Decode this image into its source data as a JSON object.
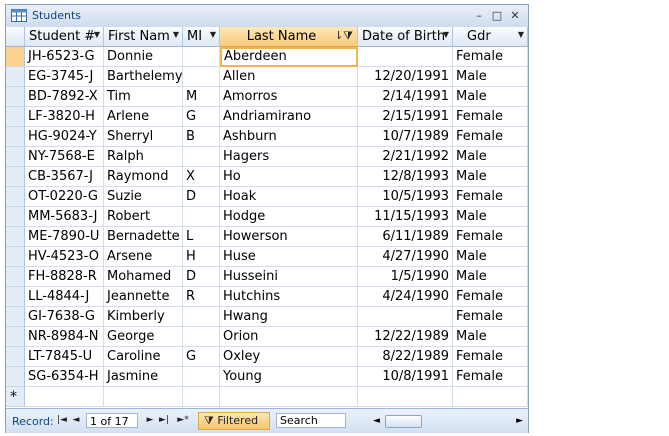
{
  "window": {
    "title": "Students",
    "minimize": "–",
    "maximize": "□",
    "close": "✕"
  },
  "columns": [
    {
      "label": "Student #",
      "has_dropdown": true
    },
    {
      "label": "First Nam",
      "has_dropdown": true
    },
    {
      "label": "MI",
      "has_dropdown": true
    },
    {
      "label": "Last Name",
      "sorted": true,
      "filtered": true
    },
    {
      "label": "Date of Birth",
      "has_dropdown": true
    },
    {
      "label": "Gdr",
      "has_dropdown": true
    }
  ],
  "rows": [
    [
      "JH-6523-G",
      "Donnie",
      "",
      "Aberdeen",
      "",
      ""
    ],
    [
      "EG-3745-J",
      "Barthelemy",
      "",
      "Allen",
      "12/20/1991",
      "Male"
    ],
    [
      "BD-7892-X",
      "Tim",
      "M",
      "Amorros",
      "2/14/1991",
      "Male"
    ],
    [
      "LF-3820-H",
      "Arlene",
      "G",
      "Andriamirano",
      "2/15/1991",
      "Female"
    ],
    [
      "HG-9024-Y",
      "Sherryl",
      "B",
      "Ashburn",
      "10/7/1989",
      "Female"
    ],
    [
      "NY-7568-E",
      "Ralph",
      "",
      "Hagers",
      "2/21/1992",
      "Male"
    ],
    [
      "CB-3567-J",
      "Raymond",
      "X",
      "Ho",
      "12/8/1993",
      "Male"
    ],
    [
      "OT-0220-G",
      "Suzie",
      "D",
      "Hoak",
      "10/5/1993",
      "Female"
    ],
    [
      "MM-5683-J",
      "Robert",
      "",
      "Hodge",
      "11/15/1993",
      "Male"
    ],
    [
      "ME-7890-U",
      "Bernadette",
      "L",
      "Howerson",
      "6/11/1989",
      "Female"
    ],
    [
      "HV-4523-O",
      "Arsene",
      "H",
      "Huse",
      "4/27/1990",
      "Male"
    ],
    [
      "FH-8828-R",
      "Mohamed",
      "D",
      "Husseini",
      "1/5/1990",
      "Male"
    ],
    [
      "LL-4844-J",
      "Jeannette",
      "R",
      "Hutchins",
      "4/24/1990",
      "Female"
    ],
    [
      "GI-7638-G",
      "Kimberly",
      "",
      "Hwang",
      "",
      "Female"
    ],
    [
      "NR-8984-N",
      "George",
      "",
      "Orion",
      "12/22/1989",
      "Male"
    ],
    [
      "LT-7845-U",
      "Caroline",
      "G",
      "Oxley",
      "8/22/1989",
      "Female"
    ],
    [
      "SG-6354-H",
      "Jasmine",
      "",
      "Young",
      "10/8/1991",
      "Female"
    ]
  ],
  "row0_first_cell": "JH-6523-G",
  "row0_gender": "Female",
  "new_row_marker": "*",
  "navigation": {
    "record_label": "Record:",
    "first": "|◄",
    "prev": "◄",
    "position": "1 of 17",
    "next": "►",
    "last": "►|",
    "new": "►*",
    "filter_label": "Filtered",
    "filter_icon": "funnel-icon",
    "search_placeholder": "Search"
  },
  "colors": {
    "accent": "#f5b24e",
    "header": "#dde7f4",
    "title_text": "#15428b"
  }
}
